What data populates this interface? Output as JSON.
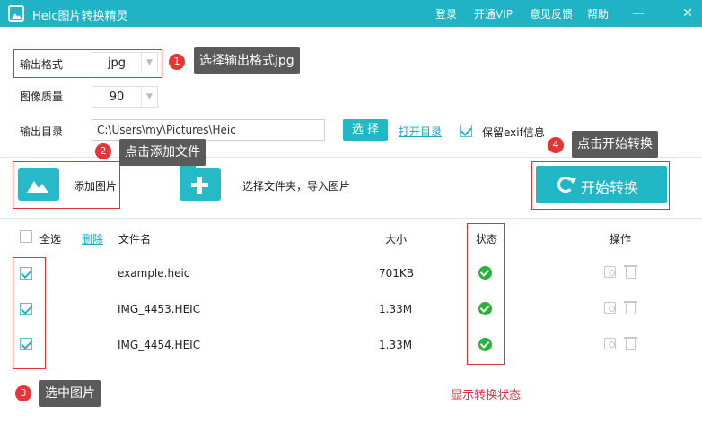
{
  "titlebar": {
    "title": "Heic图片转换精灵",
    "menu": [
      "登录",
      "开通VIP",
      "意见反馈",
      "帮助"
    ],
    "min_glyph": "—",
    "close_glyph": "✕"
  },
  "settings": {
    "format_label": "输出格式",
    "format_value": "jpg",
    "quality_label": "图像质量",
    "quality_value": "90",
    "dir_label": "输出目录",
    "dir_value": "C:\\Users\\my\\Pictures\\Heic",
    "choose_button": "选 择",
    "open_dir_link": "打开目录",
    "keep_exif_label": "保留exif信息",
    "keep_exif_checked": true
  },
  "actions": {
    "add_image": "添加图片",
    "add_folder": "选择文件夹，导入图片",
    "start": "开始转换"
  },
  "table": {
    "select_all": "全选",
    "delete": "删除",
    "columns": {
      "name": "文件名",
      "size": "大小",
      "status": "状态",
      "ops": "操作"
    },
    "rows": [
      {
        "name": "example.heic",
        "size": "701KB",
        "checked": true,
        "status": "done"
      },
      {
        "name": "IMG_4453.HEIC",
        "size": "1.33M",
        "checked": true,
        "status": "done"
      },
      {
        "name": "IMG_4454.HEIC",
        "size": "1.33M",
        "checked": true,
        "status": "done"
      }
    ]
  },
  "annotations": {
    "steps": [
      {
        "num": "1",
        "text": "选择输出格式jpg"
      },
      {
        "num": "2",
        "text": "点击添加文件"
      },
      {
        "num": "3",
        "text": "选中图片"
      },
      {
        "num": "4",
        "text": "点击开始转换"
      }
    ],
    "status_note": "显示转换状态",
    "highlight_color": "#e0313a"
  },
  "colors": {
    "accent": "#1fb3c5",
    "success": "#27b23a"
  }
}
